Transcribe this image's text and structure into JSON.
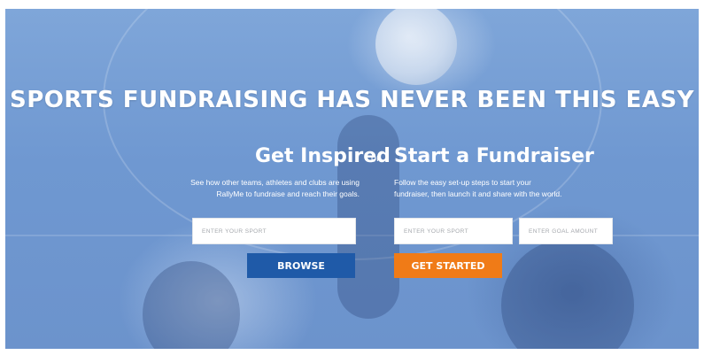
{
  "hero": {
    "headline": "SPORTS FUNDRAISING HAS NEVER BEEN THIS EASY",
    "or_text": "or"
  },
  "inspired": {
    "title": "Get Inspired",
    "description_line1": "See how other teams, athletes and clubs are using",
    "description_line2": "RallyMe to fundraise and reach their goals.",
    "sport_placeholder": "ENTER YOUR SPORT",
    "browse_label": "BROWSE"
  },
  "fundraiser": {
    "title": "Start a Fundraiser",
    "description_line1": "Follow the easy set-up steps to start your",
    "description_line2": "fundraiser, then launch it and share with the world.",
    "sport_placeholder": "ENTER YOUR SPORT",
    "goal_placeholder": "ENTER GOAL AMOUNT",
    "start_label": "GET STARTED"
  },
  "colors": {
    "browse_button": "#1f5aa8",
    "start_button": "#f07b17",
    "hero_tint": "#6f98d1"
  }
}
